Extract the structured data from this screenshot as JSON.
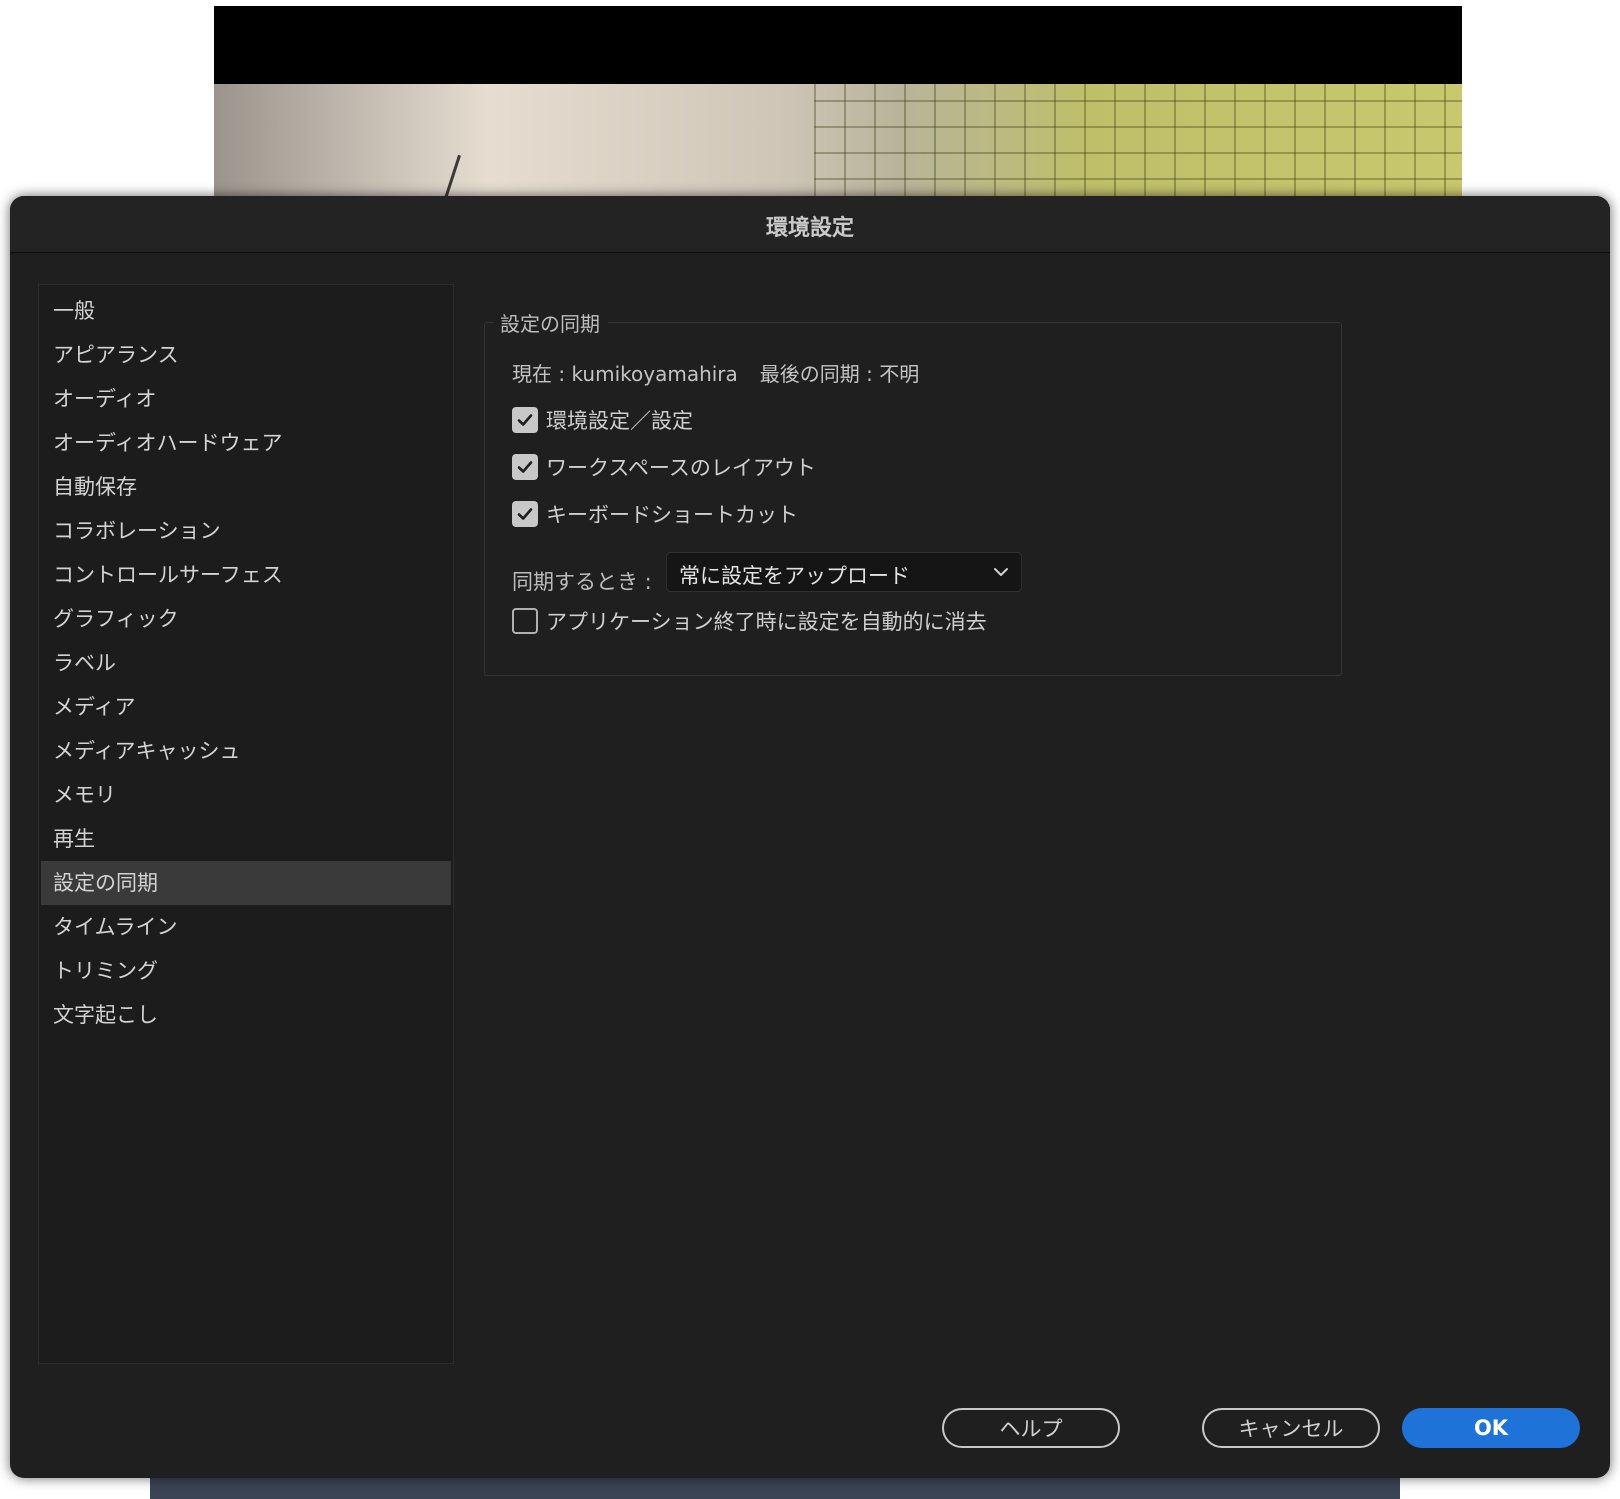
{
  "dialog": {
    "title": "環境設定"
  },
  "sidebar": {
    "items": [
      {
        "label": "一般"
      },
      {
        "label": "アピアランス"
      },
      {
        "label": "オーディオ"
      },
      {
        "label": "オーディオハードウェア"
      },
      {
        "label": "自動保存"
      },
      {
        "label": "コラボレーション"
      },
      {
        "label": "コントロールサーフェス"
      },
      {
        "label": "グラフィック"
      },
      {
        "label": "ラベル"
      },
      {
        "label": "メディア"
      },
      {
        "label": "メディアキャッシュ"
      },
      {
        "label": "メモリ"
      },
      {
        "label": "再生"
      },
      {
        "label": "設定の同期",
        "selected": true
      },
      {
        "label": "タイムライン"
      },
      {
        "label": "トリミング"
      },
      {
        "label": "文字起こし"
      }
    ]
  },
  "sync": {
    "group_title": "設定の同期",
    "current": "現在 : kumikoyamahira",
    "last_sync": "最後の同期 : 不明",
    "options": [
      {
        "label": "環境設定／設定",
        "checked": true
      },
      {
        "label": "ワークスペースのレイアウト",
        "checked": true
      },
      {
        "label": "キーボードショートカット",
        "checked": true
      }
    ],
    "when_label": "同期するとき :",
    "when_value": "常に設定をアップロード",
    "clear_on_quit": {
      "label": "アプリケーション終了時に設定を自動的に消去",
      "checked": false
    }
  },
  "buttons": {
    "help": "ヘルプ",
    "cancel": "キャンセル",
    "ok": "OK"
  },
  "colors": {
    "dialog_bg": "#1f1f1f",
    "selection": "#3a3a3a",
    "primary": "#1f73d8"
  }
}
